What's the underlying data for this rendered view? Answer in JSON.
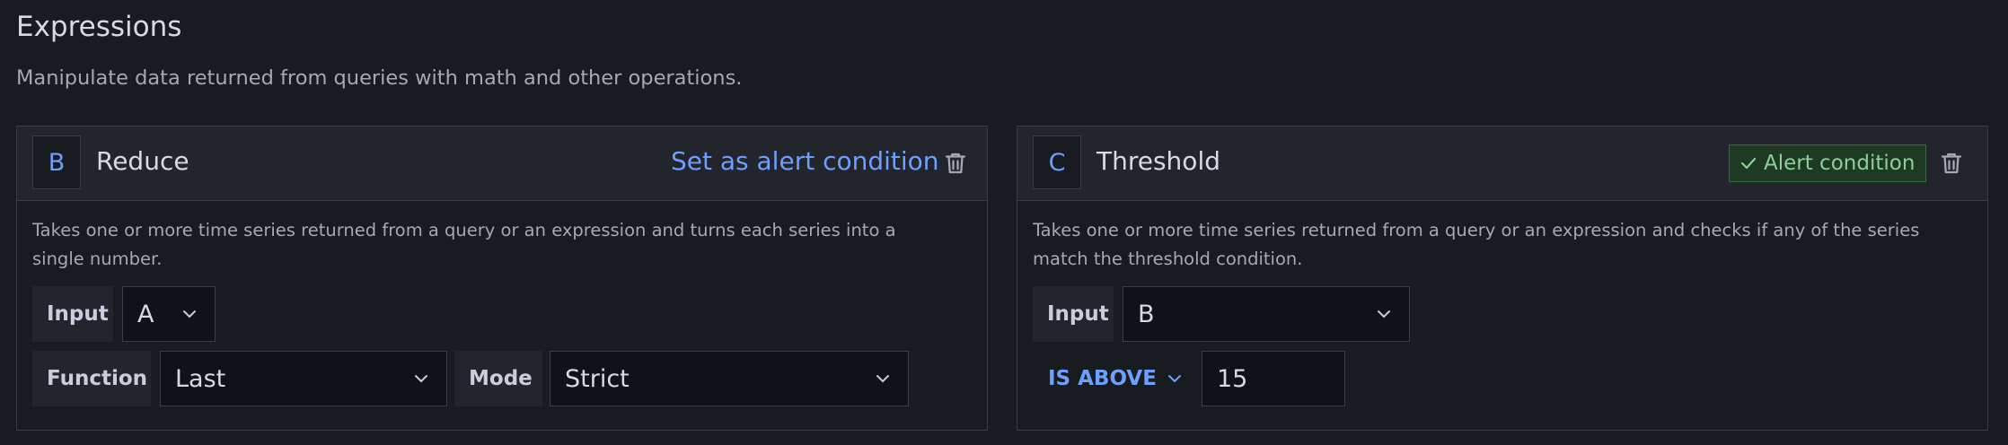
{
  "section": {
    "title": "Expressions",
    "subtitle": "Manipulate data returned from queries with math and other operations."
  },
  "reduce_card": {
    "ref_id": "B",
    "name": "Reduce",
    "set_alert_label": "Set as alert condition",
    "description": "Takes one or more time series returned from a query or an expression and turns each series into a single number.",
    "input_label": "Input",
    "input_value": "A",
    "function_label": "Function",
    "function_value": "Last",
    "mode_label": "Mode",
    "mode_value": "Strict"
  },
  "threshold_card": {
    "ref_id": "C",
    "name": "Threshold",
    "alert_badge": "Alert condition",
    "description": "Takes one or more time series returned from a query or an expression and checks if any of the series match the threshold condition.",
    "input_label": "Input",
    "input_value": "B",
    "operator": "IS ABOVE",
    "threshold_value": "15"
  },
  "colors": {
    "accent": "#6e9fff",
    "alert_green": "#8fce99",
    "background": "#181b1f"
  }
}
